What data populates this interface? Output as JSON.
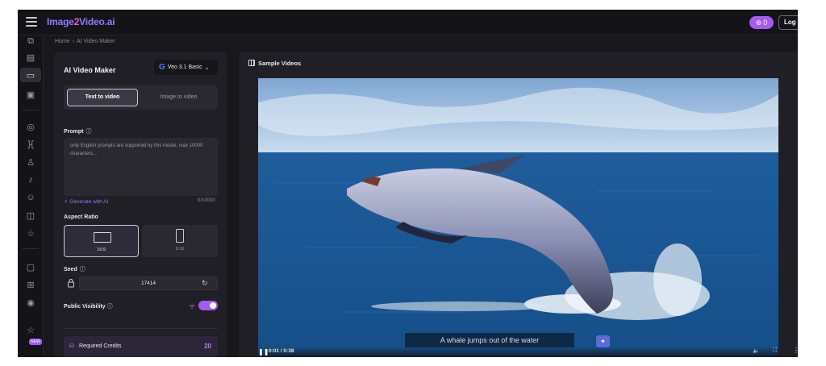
{
  "app": {
    "logo_part1": "Image",
    "logo_part2": "2",
    "logo_part3": "Video.ai",
    "credits_count": "0",
    "login_label": "Log i"
  },
  "breadcrumb": {
    "home": "Home",
    "current": "AI Video Maker"
  },
  "panel": {
    "title": "AI Video Maker",
    "model": "Veo 3.1 Basic",
    "tabs": {
      "text_to_video": "Text to video",
      "image_to_video": "Image to video"
    },
    "prompt": {
      "label": "Prompt",
      "placeholder": "only English prompts are supported by this model, max 10000 characters...",
      "generate_ai": "Generate with AI",
      "char_count": "0/10000"
    },
    "aspect": {
      "label": "Aspect Ratio",
      "wide": "16:9",
      "tall": "9:16"
    },
    "seed": {
      "label": "Seed",
      "value": "17414"
    },
    "visibility": {
      "label": "Public Visibility",
      "enabled": true
    },
    "credits": {
      "label": "Required Credits",
      "value": "20"
    }
  },
  "sample": {
    "title": "Sample Videos",
    "caption": "A whale jumps out of the water",
    "time": "0:01 / 0:38"
  },
  "rail": {
    "new_badge": "NEW"
  },
  "colors": {
    "accent": "#a35bf0",
    "background": "#18171c",
    "panel": "#201f26"
  }
}
